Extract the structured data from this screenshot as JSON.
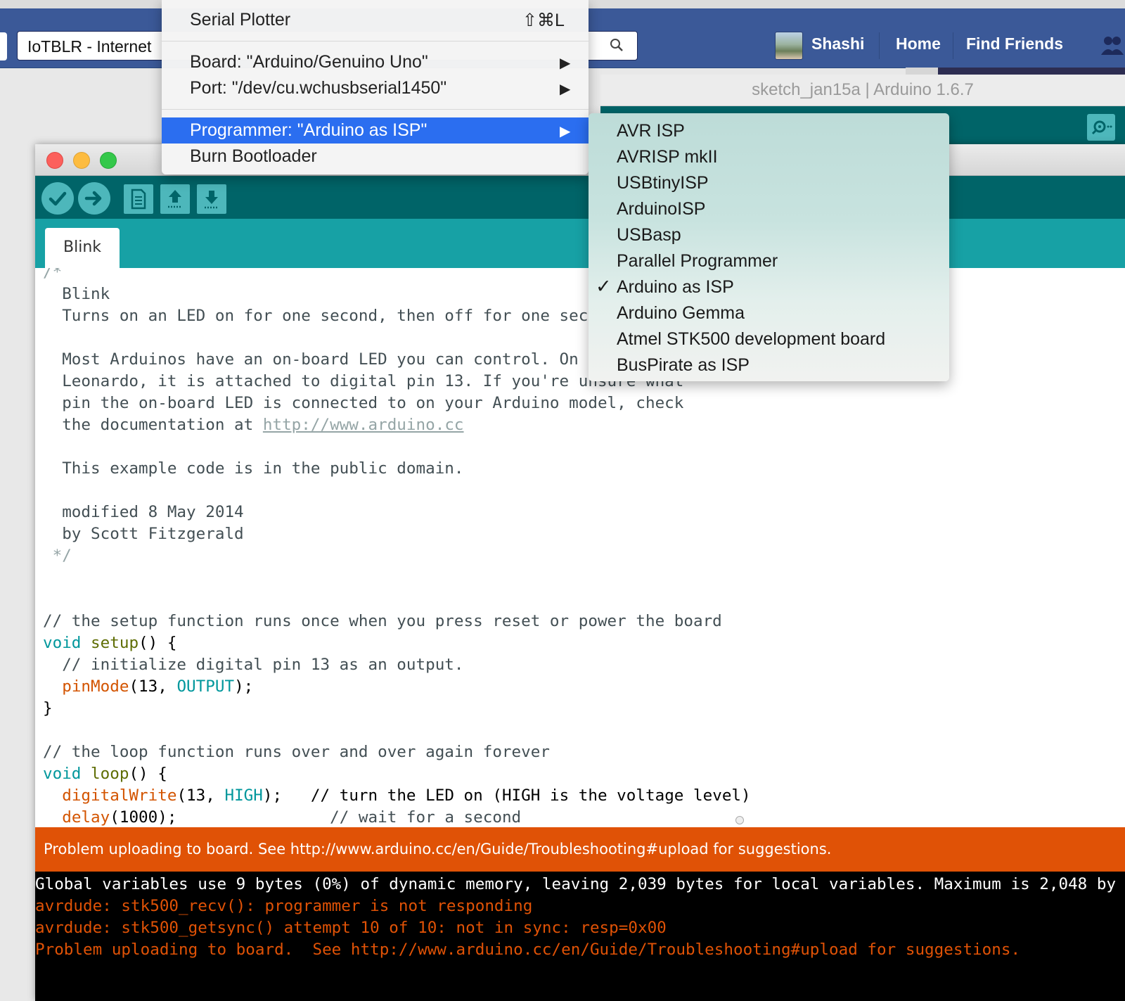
{
  "facebook": {
    "search_value": "IoTBLR - Internet",
    "user_name": "Shashi",
    "nav": [
      "Home",
      "Find Friends"
    ],
    "brand_color": "#3b5998"
  },
  "background_window": {
    "title": "sketch_jan15a | Arduino 1.6.7"
  },
  "tools_menu": {
    "items": [
      {
        "label": "Serial Plotter",
        "shortcut": "⇧⌘L"
      },
      {
        "label": "Board: \"Arduino/Genuino Uno\"",
        "submenu": true
      },
      {
        "label": "Port: \"/dev/cu.wchusbserial1450\"",
        "submenu": true
      },
      {
        "label": "Programmer: \"Arduino as ISP\"",
        "submenu": true,
        "highlighted": true
      },
      {
        "label": "Burn Bootloader"
      }
    ],
    "highlight_color": "#2b6ef0"
  },
  "programmer_submenu": {
    "items": [
      {
        "label": "AVR ISP"
      },
      {
        "label": "AVRISP mkII"
      },
      {
        "label": "USBtinyISP"
      },
      {
        "label": "ArduinoISP"
      },
      {
        "label": "USBasp"
      },
      {
        "label": "Parallel Programmer"
      },
      {
        "label": "Arduino as ISP",
        "checked": true
      },
      {
        "label": "Arduino Gemma"
      },
      {
        "label": "Atmel STK500 development board"
      },
      {
        "label": "BusPirate as ISP"
      }
    ],
    "check_mark": "✓"
  },
  "arduino": {
    "tab": "Blink",
    "toolbar_icons": [
      "verify-icon",
      "upload-icon",
      "new-icon",
      "open-icon",
      "save-icon"
    ],
    "code": {
      "l1": "/*",
      "l2": "  Blink",
      "l3": "  Turns on an LED on for one second, then off for one sec",
      "l5": "  Most Arduinos have an on-board LED you can control. On t",
      "l6": "  Leonardo, it is attached to digital pin 13. If you're unsure what",
      "l7": "  pin the on-board LED is connected to on your Arduino model, check",
      "l8_prefix": "  the documentation at ",
      "l8_url": "http://www.arduino.cc",
      "l10": "  This example code is in the public domain.",
      "l12": "  modified 8 May 2014",
      "l13": "  by Scott Fitzgerald",
      "l14": " */",
      "setup_comment": "// the setup function runs once when you press reset or power the board",
      "void1": "void",
      "setup_fn": "setup",
      "setup_rest": "() {",
      "init_comment": "  // initialize digital pin 13 as an output.",
      "pinmode_fn": "pinMode",
      "pinmode_args": "(13, ",
      "output_const": "OUTPUT",
      "pinmode_end": ");",
      "close1": "}",
      "loop_comment": "// the loop function runs over and over again forever",
      "void2": "void",
      "loop_fn": "loop",
      "loop_rest": "() {",
      "dw_fn": "digitalWrite",
      "dw_args": "(13, ",
      "high_const": "HIGH",
      "dw_end": ");   // turn the LED on (HIGH is the voltage level)",
      "delay_fn": "delay",
      "delay_args": "(1000);",
      "delay_comment": "                // wait for a second"
    },
    "status": "Problem uploading to board.  See http://www.arduino.cc/en/Guide/Troubleshooting#upload for suggestions.",
    "console": {
      "line1": "Global variables use 9 bytes (0%) of dynamic memory, leaving 2,039 bytes for local variables. Maximum is 2,048 by",
      "line2": "avrdude: stk500_recv(): programmer is not responding",
      "line3": "avrdude: stk500_getsync() attempt 10 of 10: not in sync: resp=0x00",
      "line4": "Problem uploading to board.  See http://www.arduino.cc/en/Guide/Troubleshooting#upload for suggestions."
    },
    "colors": {
      "teal_dark": "#006468",
      "teal": "#17a1a5",
      "status_orange": "#e05206",
      "error_text": "#e05206"
    }
  }
}
